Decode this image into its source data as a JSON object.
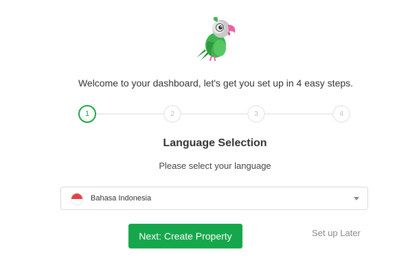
{
  "welcome_text": "Welcome to your dashboard, let's get you set up in 4 easy steps.",
  "steps": [
    {
      "label": "1",
      "active": true
    },
    {
      "label": "2",
      "active": false
    },
    {
      "label": "3",
      "active": false
    },
    {
      "label": "4",
      "active": false
    }
  ],
  "section": {
    "title": "Language Selection",
    "subtitle": "Please select your language"
  },
  "language_select": {
    "selected": "Bahasa Indonesia",
    "flag_icon": "indonesia-flag-icon",
    "caret_icon": "caret-down-icon"
  },
  "actions": {
    "next_label": "Next: Create Property",
    "later_label": "Set up Later"
  },
  "colors": {
    "accent": "#16a64b",
    "step_active": "#1fa34a",
    "step_inactive": "#c4c4c4"
  },
  "logo_icon": "parrot-logo-icon"
}
